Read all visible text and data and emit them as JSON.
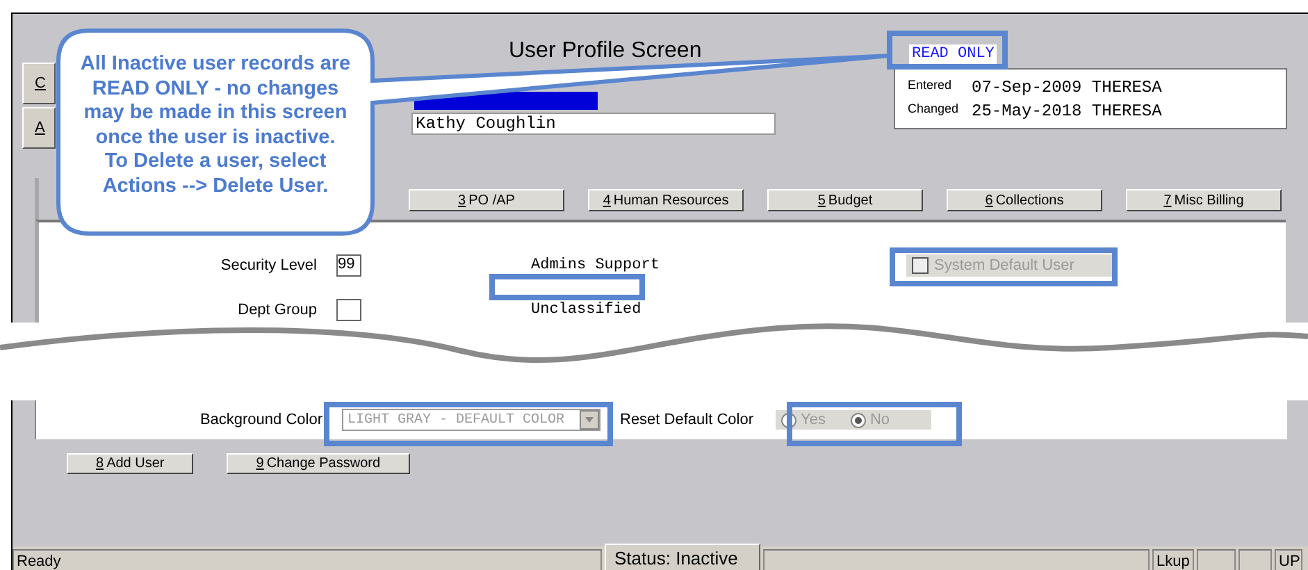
{
  "window": {
    "title": "User Profile Screen"
  },
  "left_buttons": [
    {
      "label": "C"
    },
    {
      "label": "A"
    }
  ],
  "user": {
    "name": "Kathy Coughlin"
  },
  "read_only_label": "READ ONLY",
  "audit": [
    {
      "label": "Entered",
      "value": "07-Sep-2009 THERESA"
    },
    {
      "label": "Changed",
      "value": "25-May-2018 THERESA"
    }
  ],
  "tabs": [
    {
      "key": "3",
      "label": "PO /AP",
      "selected": false
    },
    {
      "key": "4",
      "label": "Human Resources",
      "selected": false
    },
    {
      "key": "5",
      "label": "Budget",
      "selected": false
    },
    {
      "key": "6",
      "label": "Collections",
      "selected": false
    },
    {
      "key": "7",
      "label": "Misc Billing",
      "selected": false
    }
  ],
  "security_level": {
    "label": "Security Level",
    "value": "99"
  },
  "admins": "Admins Support",
  "dept_group": {
    "label": "Dept Group"
  },
  "classification": "Unclassified",
  "system_default_user": {
    "label": "System Default User",
    "checked": false,
    "disabled": true
  },
  "background_color": {
    "label": "Background Color",
    "value": "LIGHT GRAY - DEFAULT COLOR",
    "disabled": true
  },
  "reset_default_color": {
    "label": "Reset Default Color",
    "disabled": true,
    "options": [
      {
        "label": "Yes",
        "selected": false
      },
      {
        "label": "No",
        "selected": true
      }
    ]
  },
  "buttons": [
    {
      "key": "8",
      "label": "Add User"
    },
    {
      "key": "9",
      "label": "Change Password"
    }
  ],
  "status_bar": {
    "message": "Ready",
    "status": "Status: Inactive",
    "panels": [
      "Lkup",
      "UP"
    ]
  },
  "callout": {
    "lines": [
      "All Inactive user records are",
      "READ ONLY - no changes",
      "may be made in this screen",
      "once the user is inactive.",
      "To Delete a user, select",
      "Actions --> Delete User."
    ]
  }
}
